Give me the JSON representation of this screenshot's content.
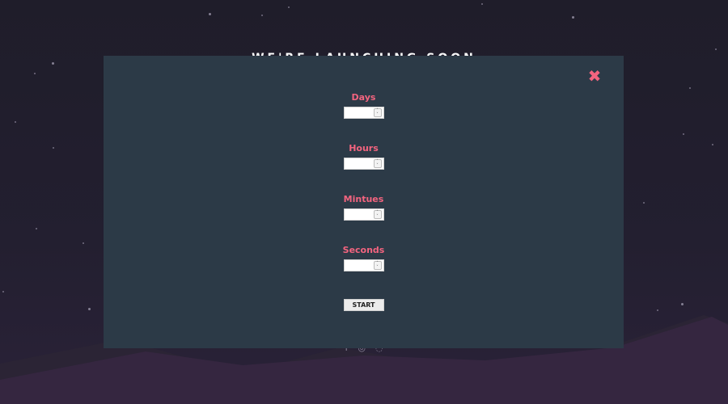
{
  "background": {
    "title": "WE'RE LAUNCHING SOON",
    "colors": {
      "sky": "#1f1d2b",
      "hills_back": "#2a2433",
      "hills_front": "#352640",
      "star": "#8a8498"
    },
    "social_icons": [
      "facebook-icon",
      "pinterest-icon",
      "instagram-icon"
    ]
  },
  "modal": {
    "background_color": "#2c3a47",
    "accent_color": "#f3647f",
    "close_glyph": "✖",
    "fields": [
      {
        "label": "Days",
        "value": "",
        "placeholder": ""
      },
      {
        "label": "Hours",
        "value": "",
        "placeholder": ""
      },
      {
        "label": "Mintues",
        "value": "",
        "placeholder": ""
      },
      {
        "label": "Seconds",
        "value": "",
        "placeholder": ""
      }
    ],
    "start_label": "START"
  }
}
